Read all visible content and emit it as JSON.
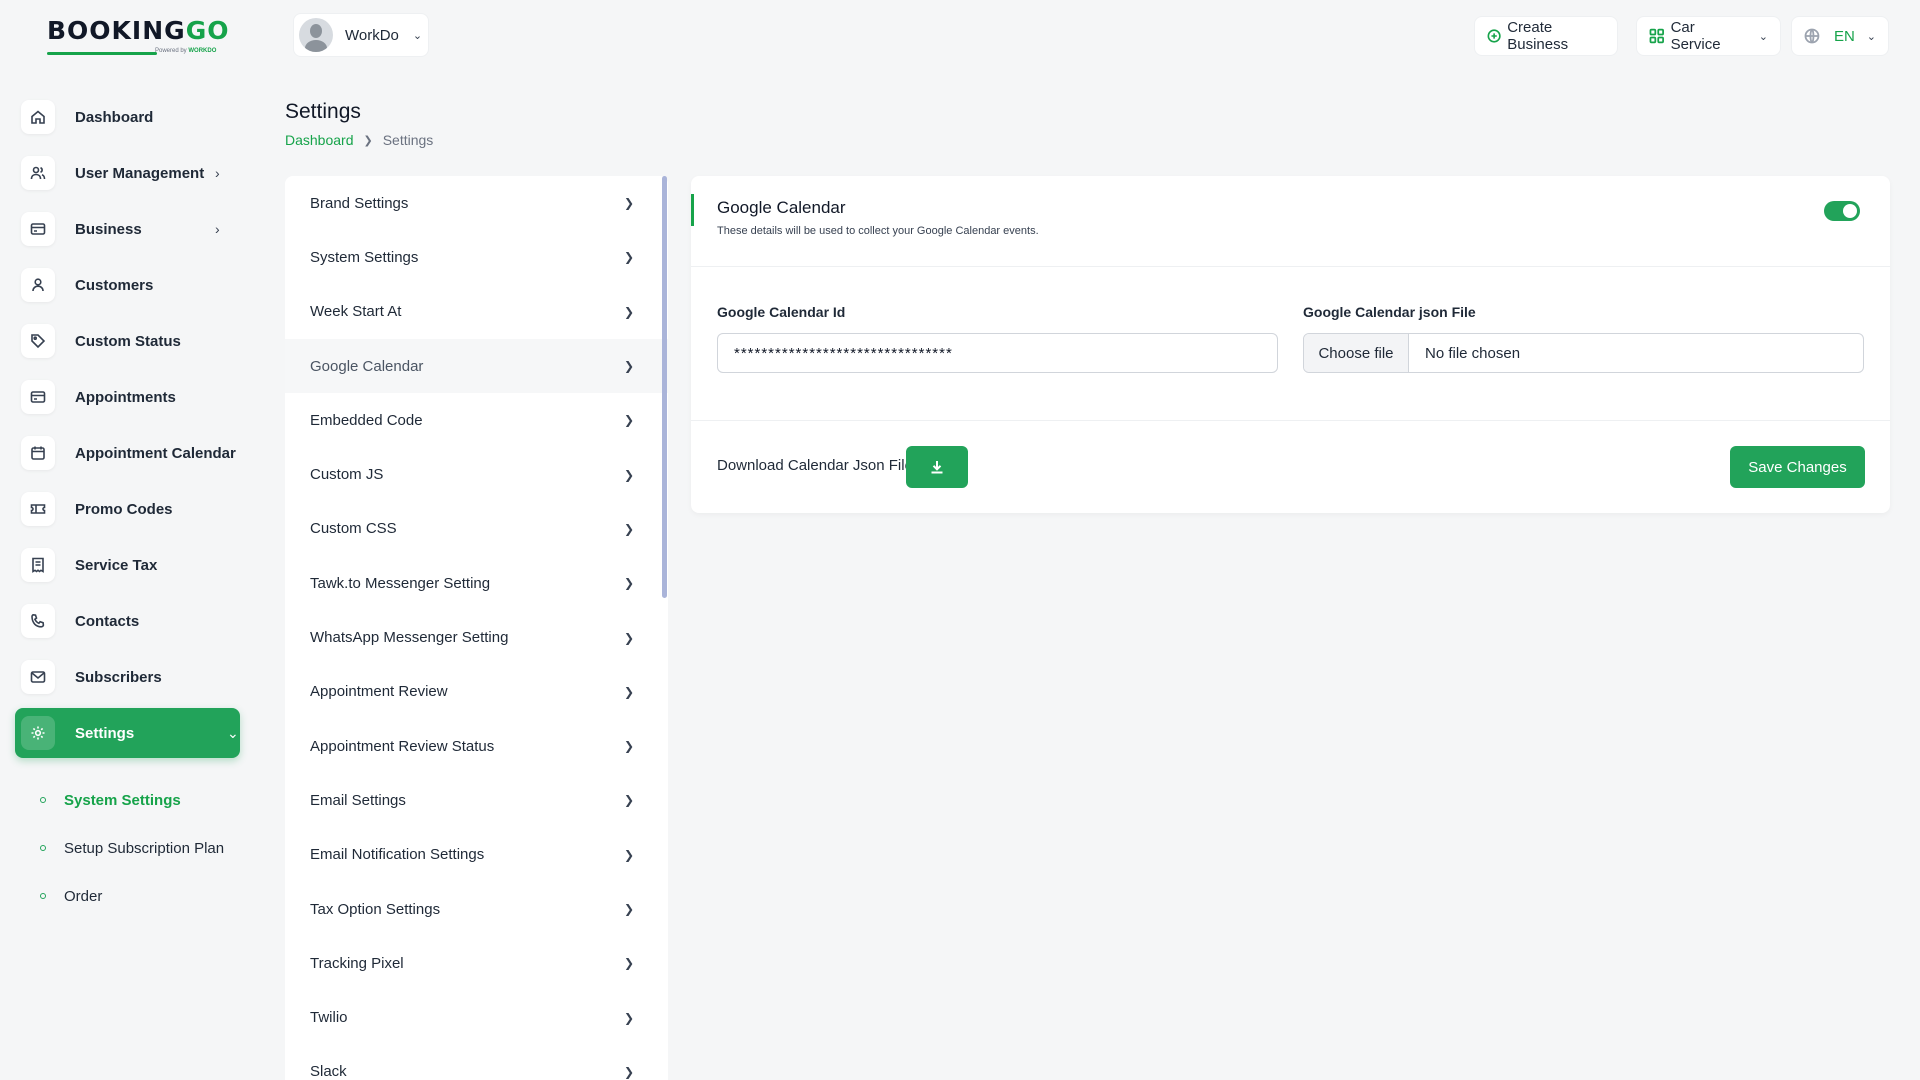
{
  "brand": {
    "name_main": "BOOKING",
    "name_accent": "GO",
    "tagline_prefix": "Powered by",
    "tagline_brand": "WORKDO"
  },
  "topbar": {
    "workspace_name": "WorkDo",
    "create_business": "Create Business",
    "service": "Car Service",
    "language": "EN"
  },
  "sidebar": {
    "items": [
      {
        "label": "Dashboard",
        "icon": "home-icon"
      },
      {
        "label": "User Management",
        "icon": "users-icon"
      },
      {
        "label": "Business",
        "icon": "card-icon"
      },
      {
        "label": "Customers",
        "icon": "user-icon"
      },
      {
        "label": "Custom Status",
        "icon": "tag-icon"
      },
      {
        "label": "Appointments",
        "icon": "card-icon"
      },
      {
        "label": "Appointment Calendar",
        "icon": "calendar-icon"
      },
      {
        "label": "Promo Codes",
        "icon": "ticket-icon"
      },
      {
        "label": "Service Tax",
        "icon": "receipt-icon"
      },
      {
        "label": "Contacts",
        "icon": "phone-icon"
      },
      {
        "label": "Subscribers",
        "icon": "mail-icon"
      },
      {
        "label": "Settings",
        "icon": "gear-icon"
      }
    ],
    "subitems": [
      {
        "label": "System Settings"
      },
      {
        "label": "Setup Subscription Plan"
      },
      {
        "label": "Order"
      }
    ]
  },
  "page": {
    "title": "Settings",
    "breadcrumb_home": "Dashboard",
    "breadcrumb_current": "Settings"
  },
  "settings_menu": [
    "Brand Settings",
    "System Settings",
    "Week Start At",
    "Google Calendar",
    "Embedded Code",
    "Custom JS",
    "Custom CSS",
    "Tawk.to Messenger Setting",
    "WhatsApp Messenger Setting",
    "Appointment Review",
    "Appointment Review Status",
    "Email Settings",
    "Email Notification Settings",
    "Tax Option Settings",
    "Tracking Pixel",
    "Twilio",
    "Slack"
  ],
  "google_calendar": {
    "title": "Google Calendar",
    "subtitle": "These details will be used to collect your Google Calendar events.",
    "enabled": true,
    "id_label": "Google Calendar Id",
    "id_value": "********************************",
    "json_label": "Google Calendar json File",
    "choose_file": "Choose file",
    "no_file": "No file chosen",
    "download_label": "Download Calendar Json File",
    "save_label": "Save Changes"
  },
  "colors": {
    "accent": "#22a35a",
    "scrollbar": "#aab4d9"
  }
}
